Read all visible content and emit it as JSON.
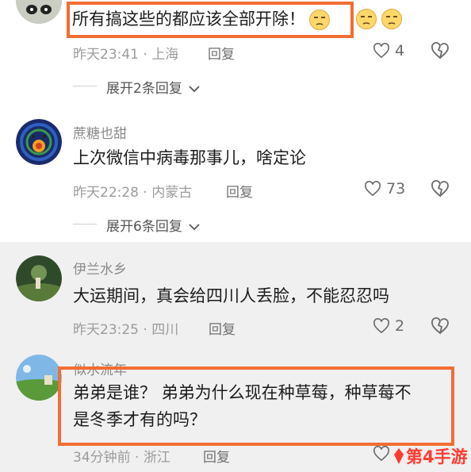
{
  "comments": [
    {
      "id": 1,
      "text": "所有搞这些的都应该全部开除！",
      "time": "昨天23:41",
      "location": "上海",
      "reply_label": "回复",
      "likes": "4",
      "replies_label": "展开2条回复"
    },
    {
      "id": 2,
      "username": "蔗糖也甜",
      "text": "上次微信中病毒那事儿，啥定论",
      "time": "昨天22:28",
      "location": "内蒙古",
      "reply_label": "回复",
      "likes": "73",
      "replies_label": "展开6条回复"
    },
    {
      "id": 3,
      "username": "伊兰水乡",
      "text": "大运期间，真会给四川人丢脸，不能忍忍吗",
      "time": "昨天23:25",
      "location": "四川",
      "reply_label": "回复",
      "likes": "2"
    },
    {
      "id": 4,
      "username": "似水流年",
      "text_line1": "弟弟是谁？ 弟弟为什么现在种草莓，种草莓不",
      "text_line2": "是冬季才有的吗？",
      "time": "34分钟前",
      "location": "浙江",
      "reply_label": "回复"
    }
  ],
  "separator": "·",
  "watermark": "第4手游",
  "colors": {
    "highlight": "#f26d33",
    "watermark": "#ff3b30"
  }
}
